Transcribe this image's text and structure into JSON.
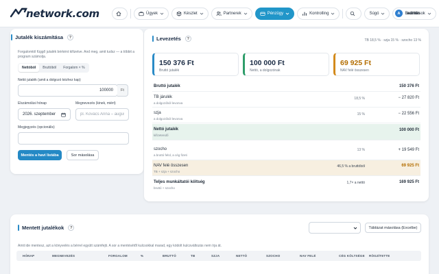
{
  "brand": {
    "name": "network.com"
  },
  "nav": {
    "items": [
      {
        "key": "home",
        "label": "",
        "icon": "home-icon"
      },
      {
        "key": "ugyek",
        "label": "Ügyek",
        "icon": "briefcase-icon"
      },
      {
        "key": "keszlet",
        "label": "Készlet",
        "icon": "box-icon"
      },
      {
        "key": "partnerek",
        "label": "Partnerek",
        "icon": "users-icon"
      },
      {
        "key": "penzugy",
        "label": "Pénzügy",
        "icon": "wallet-icon",
        "active": true
      },
      {
        "key": "kontrolling",
        "label": "Kontrolling",
        "icon": "bar-chart-icon"
      },
      {
        "key": "search",
        "label": "",
        "icon": "search-icon"
      },
      {
        "key": "sugo",
        "label": "Súgó",
        "icon": ""
      },
      {
        "key": "beallitasok",
        "label": "Beállítások",
        "icon": "gear-icon"
      }
    ],
    "user": {
      "initial": "A",
      "name": "admin"
    }
  },
  "calculator": {
    "title": "Jutalék kiszámítása",
    "help": "?",
    "description": "Forgalomtól függő jutalék bérként kifizetve. And meg, amit tudsz — a többit a program számolja.",
    "modes": [
      "Nettóból",
      "Bruttóból",
      "Forgalom × %"
    ],
    "net_label": "Nettó jutalék (amit a dolgozó kézhez kap)",
    "net_value": "100000",
    "net_suffix": "Ft",
    "month_label": "Elszámolási hónap",
    "month_value": "2026. szeptember",
    "name_label": "Megnevezés (kinek, miért)",
    "name_placeholder": "pl. Kovács Anna – auguszt",
    "note_label": "Megjegyzés (opcionális)",
    "note_value": "",
    "save_button": "Mentés a havi listába",
    "copy_button": "Sor másolása"
  },
  "breakdown": {
    "title": "Levezetés",
    "help": "?",
    "rates_note": "TB 18,5 % · szja 15 % · szocho 13 %",
    "kpis": [
      {
        "value": "150 376 Ft",
        "label": "Bruttó jutalék",
        "accent": "#2a8bc7"
      },
      {
        "value": "100 000 Ft",
        "label": "Nettó, a dolgozónak",
        "accent": "#2e9d6a"
      },
      {
        "value": "69 925 Ft",
        "label": "NAV felé összesen",
        "accent": "#d38a1b"
      }
    ],
    "rows": [
      {
        "name": "Bruttó jutalék",
        "sub": "",
        "rate": "",
        "amount": "150 376 Ft",
        "style": "bold"
      },
      {
        "name": "TB járulék",
        "sub": "a dolgozóból levonva",
        "rate": "18,5 %",
        "amount": "− 27 820 Ft",
        "style": ""
      },
      {
        "name": "szja",
        "sub": "a dolgozóból levonva",
        "rate": "15 %",
        "amount": "− 22 556 Ft",
        "style": ""
      },
      {
        "name": "Nettó jutalék",
        "sub": "kifizetendő",
        "rate": "",
        "amount": "100 000 Ft",
        "style": "net"
      },
      {
        "name": "szocho",
        "sub": "a bruttó felül, a cég fizeti",
        "rate": "13 %",
        "amount": "+ 19 549 Ft",
        "style": ""
      },
      {
        "name": "NAV felé összesen",
        "sub": "TB + szja + szocho",
        "rate": "46,5 % a bruttóból",
        "amount": "69 925 Ft",
        "style": "nav"
      },
      {
        "name": "Teljes munkáltatói költség",
        "sub": "bruttó + szocho",
        "rate": "1,7× a nettó",
        "amount": "169 925 Ft",
        "style": "bold"
      }
    ]
  },
  "saved": {
    "title": "Mentett jutalékok",
    "help": "?",
    "copy_table_button": "Táblázat másolása (Excelbe)",
    "description": "Amit ide mentesz, azt a könyvelés a bérrel együtt számfejti. A sor a mentésétől kulcsokkal marad, egy kódolt kulcsváltozás nem írja át.",
    "columns": [
      "HÓNAP",
      "MEGNEVEZÉS",
      "FORGALOM",
      "%",
      "BRUTTÓ",
      "TB",
      "SZJA",
      "NETTÓ",
      "SZOCHO",
      "NAV FELÉ",
      "CÉG KÖLTSÉGE",
      "RÖGZÍTETTE"
    ]
  }
}
